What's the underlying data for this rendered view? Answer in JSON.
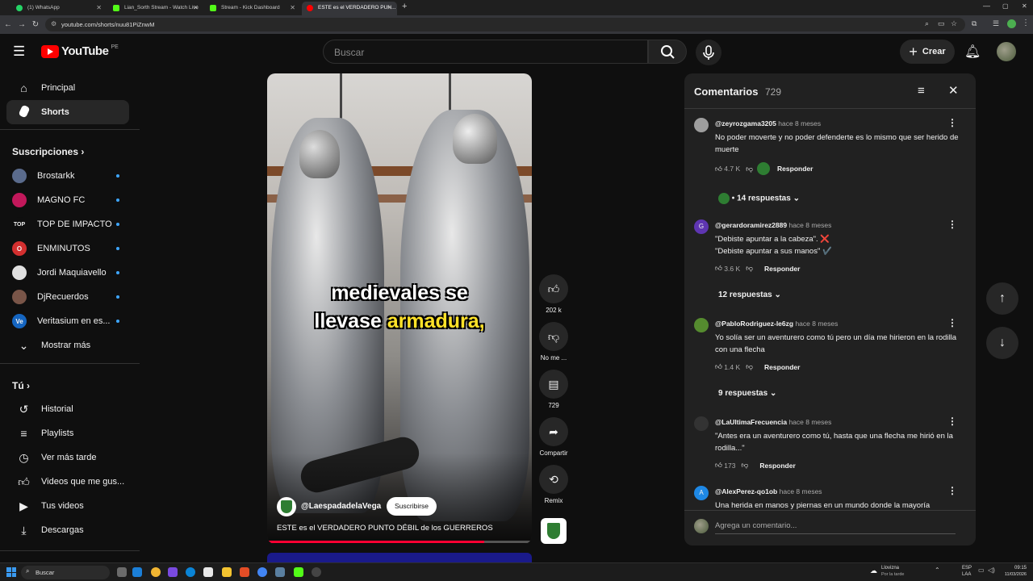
{
  "browser": {
    "tabs": [
      {
        "title": "(1) WhatsApp",
        "color": "#25d366"
      },
      {
        "title": "Lian_Sorth Stream - Watch Live",
        "color": "#53fc18"
      },
      {
        "title": "Stream - Kick Dashboard",
        "color": "#53fc18"
      },
      {
        "title": "ESTE es el VERDADERO PUN...",
        "color": "#ff0000"
      }
    ],
    "url": "youtube.com/shorts/nuu81PiZnwM"
  },
  "header": {
    "logo": "YouTube",
    "region": "PE",
    "search_placeholder": "Buscar",
    "create_label": "Crear"
  },
  "sidebar": {
    "main": [
      {
        "label": "Principal",
        "icon": "home-icon"
      },
      {
        "label": "Shorts",
        "icon": "shorts-icon"
      }
    ],
    "subs_title": "Suscripciones",
    "subs": [
      {
        "label": "Brostarkk",
        "color": "#5a6b8c",
        "abbr": ""
      },
      {
        "label": "MAGNO FC",
        "color": "#c2185b",
        "abbr": ""
      },
      {
        "label": "TOP DE IMPACTO",
        "color": "#0f0f0f",
        "abbr": "TOP"
      },
      {
        "label": "ENMINUTOS",
        "color": "#d32f2f",
        "abbr": "O"
      },
      {
        "label": "Jordi Maquiavello",
        "color": "#e0e0e0",
        "abbr": ""
      },
      {
        "label": "DjRecuerdos",
        "color": "#795548",
        "abbr": ""
      },
      {
        "label": "Veritasium en es...",
        "color": "#1565c0",
        "abbr": "Ve"
      }
    ],
    "show_more": "Mostrar más",
    "you_title": "Tú",
    "you_items": [
      {
        "label": "Historial",
        "icon": "history-icon"
      },
      {
        "label": "Playlists",
        "icon": "playlist-icon"
      },
      {
        "label": "Ver más tarde",
        "icon": "clock-icon"
      },
      {
        "label": "Videos que me gus...",
        "icon": "like-icon"
      },
      {
        "label": "Tus videos",
        "icon": "video-icon"
      },
      {
        "label": "Descargas",
        "icon": "download-icon"
      }
    ]
  },
  "short": {
    "caption_line1": "medievales se",
    "caption_line2_a": "llevase ",
    "caption_line2_b": "armadura,",
    "channel": "@LaespadadelaVega",
    "subscribe": "Suscribirse",
    "title": "ESTE es el VERDADERO PUNTO DÉBIL de los GUERREROS",
    "progress": 0.82
  },
  "actions": {
    "likes": "202 k",
    "dislike": "No me ...",
    "comments": "729",
    "share": "Compartir",
    "remix": "Remix"
  },
  "comments": {
    "title": "Comentarios",
    "count": "729",
    "add_placeholder": "Agrega un comentario...",
    "items": [
      {
        "user": "@zeyrozgama3205",
        "time": "hace 8 meses",
        "text": "No poder moverte y no poder defenderte es lo mismo que ser herido de muerte",
        "likes": "4.7 K",
        "replies": "14 respuestas",
        "av": "#9e9e9e"
      },
      {
        "user": "@gerardoramirez2889",
        "time": "hace 8 meses",
        "text": "\"Debiste apuntar a la cabeza\". ❌",
        "text2": "\"Debiste apuntar a sus manos\" ✔️",
        "likes": "3.6 K",
        "replies": "12 respuestas",
        "av": "#5e35b1",
        "letter": "G"
      },
      {
        "user": "@PabloRodriguez-le6zg",
        "time": "hace 8 meses",
        "text": "Yo solía ser un aventurero como tú pero un día me hirieron en la rodilla con una flecha",
        "likes": "1.4 K",
        "replies": "9 respuestas",
        "av": "#558b2f"
      },
      {
        "user": "@LaUltimaFrecuencia",
        "time": "hace 8 meses",
        "text": "\"Antes era un aventurero como tú, hasta que una flecha me hirió en la rodilla...\"",
        "likes": "173",
        "av": "#333333"
      },
      {
        "user": "@AlexPerez-qo1ob",
        "time": "hace 8 meses",
        "text": "Una herida en manos y piernas en un mundo donde la mayoría",
        "av": "#1e88e5",
        "letter": "A"
      }
    ],
    "reply_label": "Responder"
  },
  "taskbar": {
    "search": "Buscar",
    "weather": "Llovizna",
    "weather_sub": "Por la tarde",
    "lang": "ESP",
    "lang_sub": "LAA",
    "time": "09:15",
    "date": "11/03/2026"
  }
}
